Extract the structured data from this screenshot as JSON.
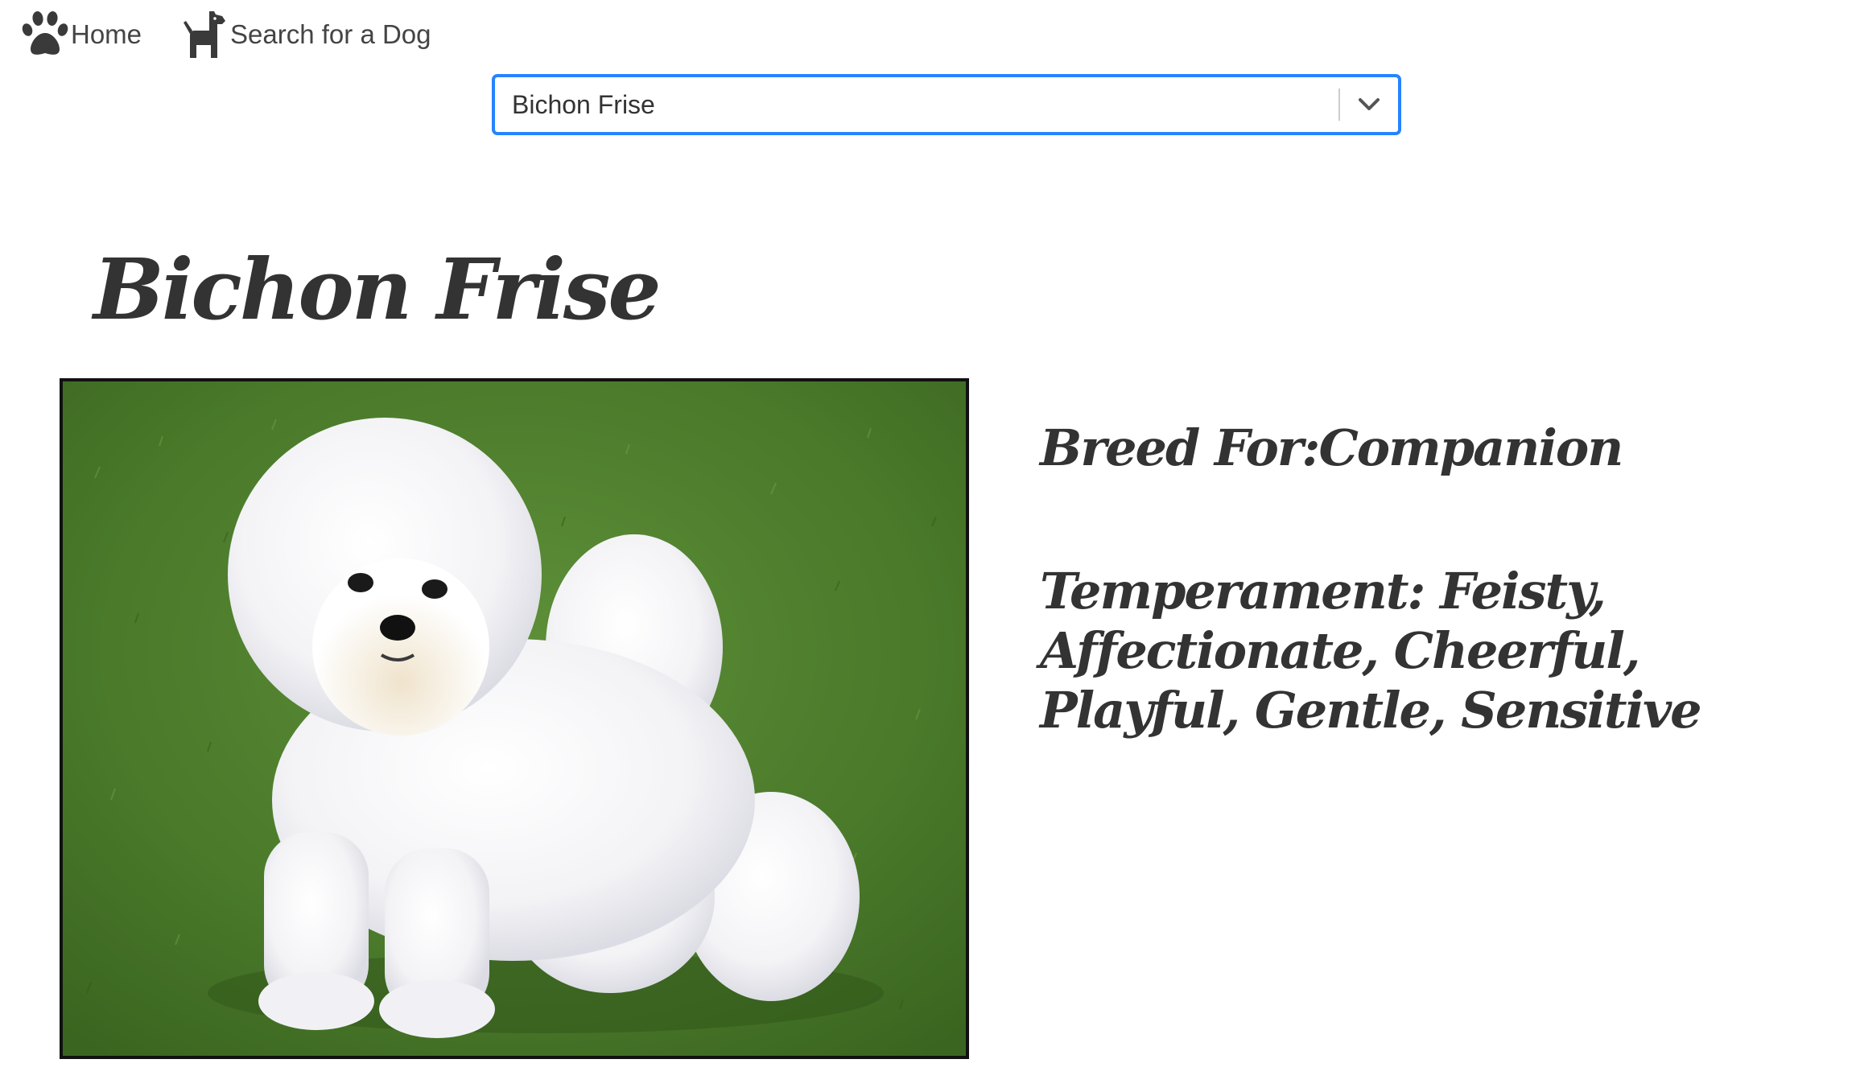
{
  "nav": {
    "items": [
      {
        "label": "Home",
        "icon": "paw-icon"
      },
      {
        "label": "Search for a Dog",
        "icon": "dog-icon"
      }
    ]
  },
  "breed_select": {
    "selected": "Bichon Frise"
  },
  "breed": {
    "name": "Bichon Frise",
    "bred_for_label": "Breed For:",
    "bred_for": "Companion",
    "temperament_label": "Temperament: ",
    "temperament": "Feisty, Affectionate, Cheerful, Playful, Gentle, Sensitive"
  },
  "colors": {
    "text": "#333333",
    "select_border": "#2684ff",
    "grass": "#4c7a2c"
  }
}
